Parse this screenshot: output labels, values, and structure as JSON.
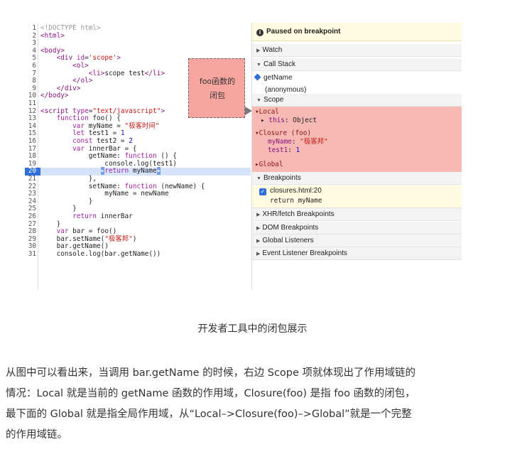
{
  "code_lines": [
    {
      "n": "1",
      "html": "<span class='c'>&lt;!DOCTYPE html&gt;</span>"
    },
    {
      "n": "2",
      "html": "<span class='t'>&lt;html&gt;</span>"
    },
    {
      "n": "3",
      "html": ""
    },
    {
      "n": "4",
      "html": "<span class='t'>&lt;body&gt;</span>"
    },
    {
      "n": "5",
      "html": "    <span class='t'>&lt;div</span> <span class='k'>id</span>=<span class='s'>'scope'</span><span class='t'>&gt;</span>"
    },
    {
      "n": "6",
      "html": "        <span class='t'>&lt;ol&gt;</span>"
    },
    {
      "n": "7",
      "html": "            <span class='t'>&lt;li&gt;</span>scope test<span class='t'>&lt;/li&gt;</span>"
    },
    {
      "n": "8",
      "html": "        <span class='t'>&lt;/ol&gt;</span>"
    },
    {
      "n": "9",
      "html": "    <span class='t'>&lt;/div&gt;</span>"
    },
    {
      "n": "10",
      "html": "<span class='t'>&lt;/body&gt;</span>"
    },
    {
      "n": "11",
      "html": ""
    },
    {
      "n": "12",
      "html": "<span class='t'>&lt;script</span> <span class='k'>type</span>=<span class='s'>\"text/javascript\"</span><span class='t'>&gt;</span>"
    },
    {
      "n": "13",
      "html": "    <span class='k'>function</span> foo() {"
    },
    {
      "n": "14",
      "html": "        <span class='k'>var</span> myName = <span class='s'>\"极客时间\"</span>"
    },
    {
      "n": "15",
      "html": "        <span class='k'>let</span> test1 = <span class='v'>1</span>"
    },
    {
      "n": "16",
      "html": "        <span class='k'>const</span> test2 = <span class='v'>2</span>"
    },
    {
      "n": "17",
      "html": "        <span class='k'>var</span> innerBar = {"
    },
    {
      "n": "18",
      "html": "            getName: <span class='k'>function</span> () {"
    },
    {
      "n": "19",
      "html": "                console.log(test1)"
    },
    {
      "n": "20",
      "html": "               <span class='bp'>▸</span><span class='k'>return</span> myName<span class='bp'>▸</span>"
    },
    {
      "n": "21",
      "html": "            },"
    },
    {
      "n": "22",
      "html": "            setName: <span class='k'>function</span> (newName) {"
    },
    {
      "n": "23",
      "html": "                myName = newName"
    },
    {
      "n": "24",
      "html": "            }"
    },
    {
      "n": "25",
      "html": "        }"
    },
    {
      "n": "26",
      "html": "        <span class='k'>return</span> innerBar"
    },
    {
      "n": "27",
      "html": "    }"
    },
    {
      "n": "28",
      "html": "    <span class='k'>var</span> bar = foo()"
    },
    {
      "n": "29",
      "html": "    bar.setName(<span class='s'>\"极客邦\"</span>)"
    },
    {
      "n": "30",
      "html": "    bar.getName()"
    },
    {
      "n": "31",
      "html": "    console.log(bar.getName())"
    }
  ],
  "callout": {
    "line1": "foo函数的",
    "line2": "闭包"
  },
  "panel": {
    "paused": "Paused on breakpoint",
    "watch": "Watch",
    "call_stack": "Call Stack",
    "stack_1": "getName",
    "stack_2": "(anonymous)",
    "scope": "Scope",
    "scope_lines": {
      "local": "Local",
      "this_key": "this",
      "this_val": "Object",
      "closure": "Closure (foo)",
      "myname_key": "myName",
      "myname_val": "\"极客邦\"",
      "test1_key": "test1",
      "test1_val": "1",
      "global": "Global"
    },
    "breakpoints": "Breakpoints",
    "bp_file": "closures.html:20",
    "bp_code": "return myName",
    "xhr": "XHR/fetch Breakpoints",
    "dom": "DOM Breakpoints",
    "global_listeners": "Global Listeners",
    "event_listeners": "Event Listener Breakpoints"
  },
  "caption": "开发者工具中的闭包展示",
  "paragraph": [
    "从图中可以看出来，当调用 bar.getName 的时候，右边 Scope 项就体现出了作用域链的",
    "情况：Local 就是当前的 getName 函数的作用域，Closure(foo) 是指 foo 函数的闭包，",
    "最下面的 Global 就是指全局作用域，从“Local–>Closure(foo)–>Global”就是一个完整",
    "的作用域链。"
  ]
}
